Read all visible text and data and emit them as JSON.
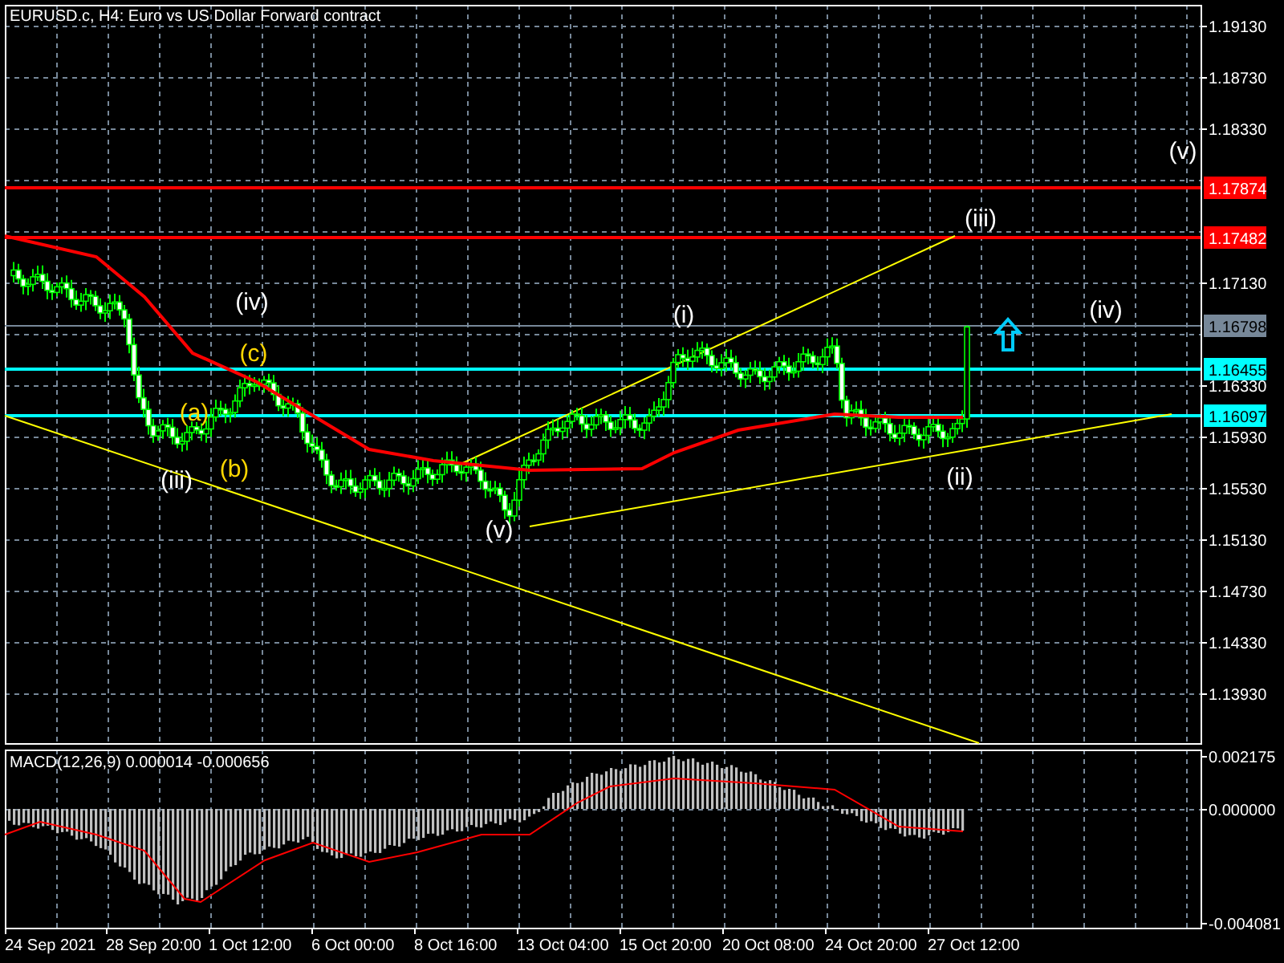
{
  "chart_title": "EURUSD.c, H4:  Euro vs US Dollar Forward contract",
  "price_axis": [
    "1.19130",
    "1.18730",
    "1.18330",
    "1.17130",
    "1.16330",
    "1.15930",
    "1.15530",
    "1.15130",
    "1.14730",
    "1.14330",
    "1.13930"
  ],
  "price_levels": [
    {
      "label": "1.17874",
      "color": "#ff0000"
    },
    {
      "label": "1.17482",
      "color": "#ff0000"
    },
    {
      "label": "1.16798",
      "color": "#778899"
    },
    {
      "label": "1.16455",
      "color": "#00ffff"
    },
    {
      "label": "1.16097",
      "color": "#00ffff"
    }
  ],
  "wave_labels": [
    {
      "text": "(iv)",
      "color": "#ffffff"
    },
    {
      "text": "(c)",
      "color": "#ffd700"
    },
    {
      "text": "(a)",
      "color": "#ffd700"
    },
    {
      "text": "(b)",
      "color": "#ffd700"
    },
    {
      "text": "(iii)",
      "color": "#ffffff"
    },
    {
      "text": "(v)",
      "color": "#ffffff"
    },
    {
      "text": "(i)",
      "color": "#ffffff"
    },
    {
      "text": "(ii)",
      "color": "#ffffff"
    },
    {
      "text": "(iii)",
      "color": "#ffffff"
    },
    {
      "text": "(iv)",
      "color": "#ffffff"
    },
    {
      "text": "(v)",
      "color": "#ffffff"
    }
  ],
  "macd": {
    "title": "MACD(12,26,9) 0.000014 -0.000656",
    "axis": [
      "0.002175",
      "0.000000",
      "-0.004081"
    ]
  },
  "time_axis": [
    "24 Sep 2021",
    "28 Sep 20:00",
    "1 Oct 12:00",
    "6 Oct 00:00",
    "8 Oct 16:00",
    "13 Oct 04:00",
    "15 Oct 20:00",
    "20 Oct 08:00",
    "24 Oct 20:00",
    "27 Oct 12:00"
  ]
}
